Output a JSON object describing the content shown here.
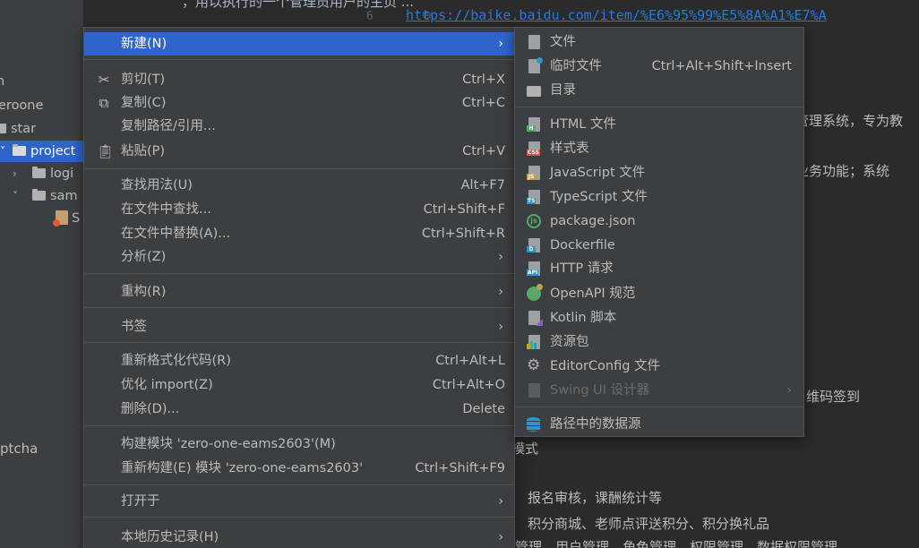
{
  "tree": {
    "items": [
      {
        "label": "n",
        "chev": ""
      },
      {
        "label": "eroone",
        "chev": ""
      },
      {
        "label": "star",
        "chev": ""
      },
      {
        "label": "project",
        "chev": "˅"
      },
      {
        "label": "logi",
        "chev": "›"
      },
      {
        "label": "sam",
        "chev": "˅"
      },
      {
        "label": "S",
        "chev": ""
      }
    ],
    "captcha": "ptcha"
  },
  "editor": {
    "top_cut_text": "，用以执行的一个管理员用户的主页 ...",
    "line_number": "6",
    "url": "https://baike.baidu.com/item/%E6%95%99%E5%8A%A1%E7%A",
    "text_fragments": {
      "t1": "管理系统，专为教",
      "t2": "办业务功能；系统",
      "t3": "维码签到",
      "t4": "模式",
      "t5": "报名审核，课酬统计等",
      "t6": "积分商城、老师点评送积分、积分换礼品",
      "t7": "管理、用户管理、角色管理、权限管理、数据权限管理"
    }
  },
  "menu": {
    "new": {
      "label": "新建(N)",
      "arrow": "›"
    },
    "cut": {
      "label": "剪切(T)",
      "shortcut": "Ctrl+X",
      "icon": "scissors-icon"
    },
    "copy": {
      "label": "复制(C)",
      "shortcut": "Ctrl+C",
      "icon": "copy-icon"
    },
    "copy_path": {
      "label": "复制路径/引用..."
    },
    "paste": {
      "label": "粘贴(P)",
      "shortcut": "Ctrl+V",
      "icon": "clipboard-icon"
    },
    "find_usages": {
      "label": "查找用法(U)",
      "shortcut": "Alt+F7"
    },
    "find_in_files": {
      "label": "在文件中查找...",
      "shortcut": "Ctrl+Shift+F"
    },
    "replace_in_files": {
      "label": "在文件中替换(A)...",
      "shortcut": "Ctrl+Shift+R"
    },
    "analyze": {
      "label": "分析(Z)",
      "arrow": "›"
    },
    "refactor": {
      "label": "重构(R)",
      "arrow": "›"
    },
    "bookmarks": {
      "label": "书签",
      "arrow": "›"
    },
    "reformat": {
      "label": "重新格式化代码(R)",
      "shortcut": "Ctrl+Alt+L"
    },
    "optimize": {
      "label": "优化 import(Z)",
      "shortcut": "Ctrl+Alt+O"
    },
    "delete": {
      "label": "删除(D)...",
      "shortcut": "Delete"
    },
    "build": {
      "label": "构建模块 'zero-one-eams2603'(M)"
    },
    "rebuild": {
      "label": "重新构建(E) 模块 'zero-one-eams2603'",
      "shortcut": "Ctrl+Shift+F9"
    },
    "open_in": {
      "label": "打开于",
      "arrow": "›"
    },
    "local_history": {
      "label": "本地历史记录(H)",
      "arrow": "›"
    }
  },
  "submenu": {
    "file": {
      "label": "文件"
    },
    "scratch": {
      "label": "临时文件",
      "shortcut": "Ctrl+Alt+Shift+Insert"
    },
    "directory": {
      "label": "目录"
    },
    "html": {
      "label": "HTML 文件",
      "tag": "H"
    },
    "stylesheet": {
      "label": "样式表",
      "tag": "CSS"
    },
    "javascript": {
      "label": "JavaScript 文件",
      "tag": "JS"
    },
    "typescript": {
      "label": "TypeScript 文件",
      "tag": "TS"
    },
    "package_json": {
      "label": "package.json",
      "glyph": "js"
    },
    "dockerfile": {
      "label": "Dockerfile",
      "tag": "D"
    },
    "http": {
      "label": "HTTP 请求",
      "tag": "API"
    },
    "openapi": {
      "label": "OpenAPI 规范"
    },
    "kotlin": {
      "label": "Kotlin 脚本"
    },
    "resource_bundle": {
      "label": "资源包"
    },
    "editorconfig": {
      "label": "EditorConfig 文件"
    },
    "swing": {
      "label": "Swing UI 设计器",
      "arrow": "›"
    },
    "datasource": {
      "label": "路径中的数据源"
    }
  },
  "colors": {
    "selection": "#2f65ca",
    "menu_bg": "#3c3f41",
    "editor_bg": "#2b2b2b",
    "link": "#287bde"
  }
}
